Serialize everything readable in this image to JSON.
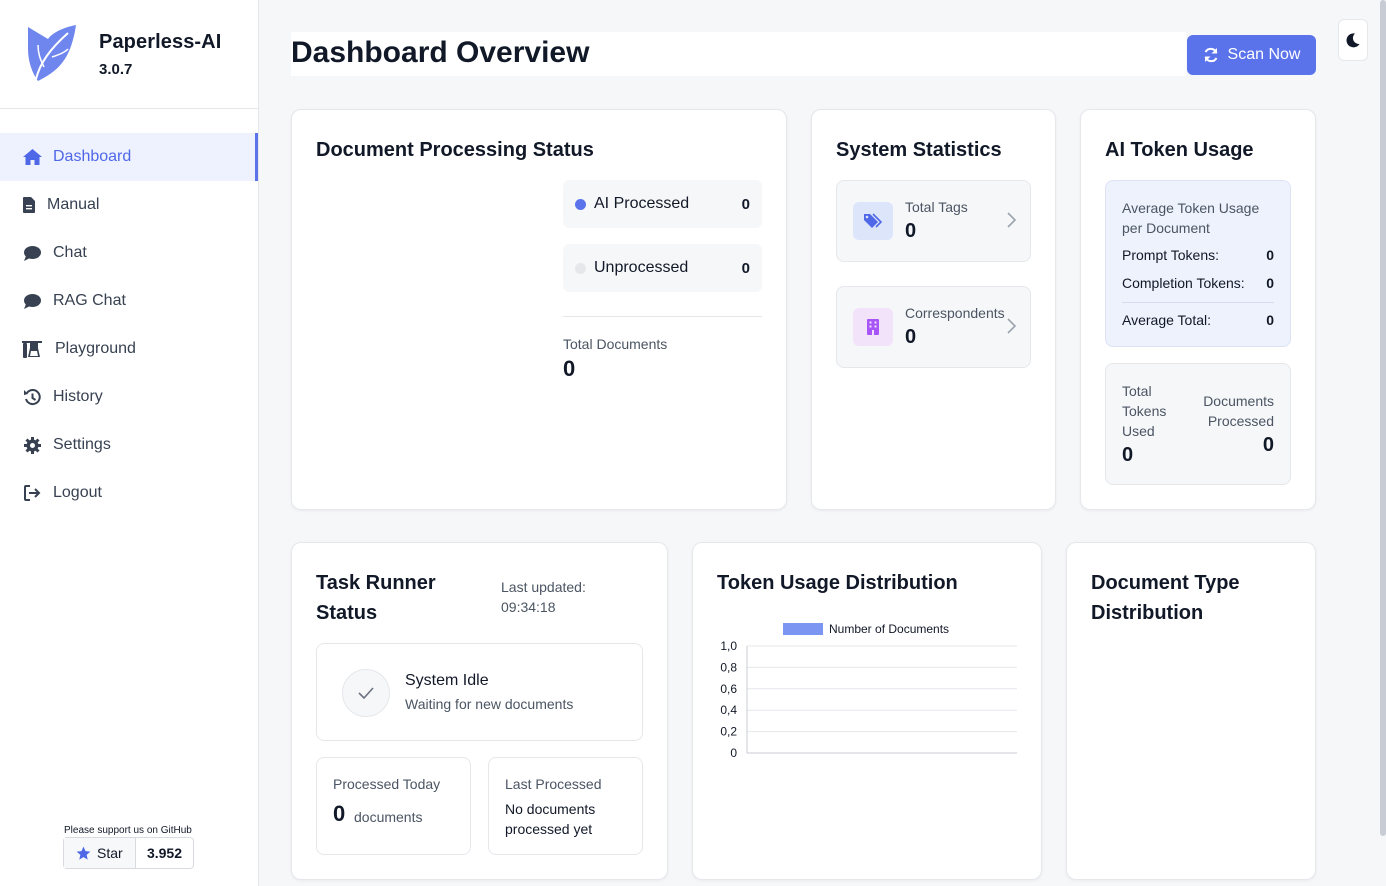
{
  "app": {
    "name": "Paperless-AI",
    "version": "3.0.7"
  },
  "sidebar": {
    "items": [
      {
        "label": "Dashboard",
        "icon": "home-icon",
        "active": true
      },
      {
        "label": "Manual",
        "icon": "file-icon"
      },
      {
        "label": "Chat",
        "icon": "chat-icon"
      },
      {
        "label": "RAG Chat",
        "icon": "chat-icon"
      },
      {
        "label": "Playground",
        "icon": "flask-icon"
      },
      {
        "label": "History",
        "icon": "history-icon"
      },
      {
        "label": "Settings",
        "icon": "gear-icon"
      },
      {
        "label": "Logout",
        "icon": "logout-icon"
      }
    ],
    "support_text": "Please support us on GitHub",
    "star_label": "Star",
    "star_count": "3.952"
  },
  "header": {
    "title": "Dashboard Overview",
    "scan_label": "Scan Now"
  },
  "processing": {
    "title": "Document Processing Status",
    "ai_processed_label": "AI Processed",
    "ai_processed_value": "0",
    "unprocessed_label": "Unprocessed",
    "unprocessed_value": "0",
    "total_label": "Total Documents",
    "total_value": "0"
  },
  "stats": {
    "title": "System Statistics",
    "tags_label": "Total Tags",
    "tags_value": "0",
    "correspondents_label": "Correspondents",
    "correspondents_value": "0"
  },
  "tokens": {
    "title": "AI Token Usage",
    "avg_heading": "Average Token Usage per Document",
    "prompt_label": "Prompt Tokens:",
    "prompt_value": "0",
    "completion_label": "Completion Tokens:",
    "completion_value": "0",
    "avg_total_label": "Average Total:",
    "avg_total_value": "0",
    "total_used_label": "Total Tokens Used",
    "total_used_value": "0",
    "docs_processed_label": "Documents Processed",
    "docs_processed_value": "0"
  },
  "task_runner": {
    "title": "Task Runner Status",
    "updated_label": "Last updated:",
    "updated_time": "09:34:18",
    "status_title": "System Idle",
    "status_sub": "Waiting for new documents",
    "today_label": "Processed Today",
    "today_value": "0",
    "today_unit": "documents",
    "last_label": "Last Processed",
    "last_value": "No documents processed yet"
  },
  "token_distribution": {
    "title": "Token Usage Distribution"
  },
  "doc_type_distribution": {
    "title": "Document Type Distribution"
  },
  "chart_data": {
    "type": "bar",
    "categories": [],
    "series": [
      {
        "name": "Number of Documents",
        "values": [],
        "color": "#7b96f2"
      }
    ],
    "ylim": [
      0,
      1
    ],
    "yticks": [
      "1,0",
      "0,8",
      "0,6",
      "0,4",
      "0,2",
      "0"
    ],
    "grid": true,
    "legend": "top"
  },
  "colors": {
    "accent": "#5b73ea",
    "ai_processed": "#5b73ea",
    "unprocessed": "#e5e7eb"
  }
}
